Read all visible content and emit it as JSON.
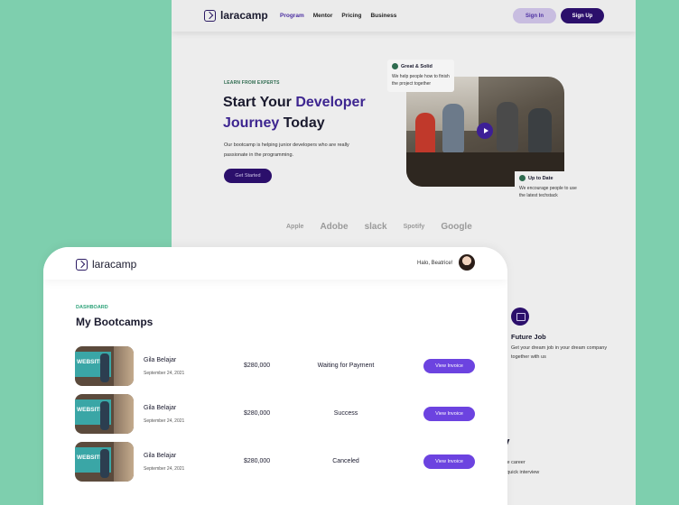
{
  "landing": {
    "logo": "laracamp",
    "menu": [
      "Program",
      "Mentor",
      "Pricing",
      "Business"
    ],
    "signin": "Sign In",
    "signup": "Sign Up",
    "eyebrow": "LEARN FROM EXPERTS",
    "title_1": "Start Your ",
    "title_hl1": "Developer",
    "title_hl2": "Journey",
    "title_2": " Today",
    "desc": "Our bootcamp is helping junior developers who are really passionate in the programming.",
    "cta": "Get Started",
    "card_great": {
      "title": "Great & Solid",
      "text": "We help people how to finish the project together"
    },
    "card_up": {
      "title": "Up to Date",
      "text": "We encourage people to use the latest techstack"
    },
    "brands": [
      "Apple",
      "Adobe",
      "slack",
      "Spotify",
      "Google"
    ],
    "future": {
      "title": "Future Job",
      "text": "Get your dream job in your dream company together with us"
    },
    "partial_heading": "ey",
    "partial_line1": "uture career",
    "partial_line2": "g a quick interview"
  },
  "dashboard": {
    "logo": "laracamp",
    "greeting": "Halo, Beatrice!",
    "eyebrow": "DASHBOARD",
    "title": "My Bootcamps",
    "thumb_text": "WEBSITE",
    "rows": [
      {
        "name": "Gila Belajar",
        "date": "September 24, 2021",
        "price": "$280,000",
        "status": "Waiting for Payment",
        "action": "View Invoice"
      },
      {
        "name": "Gila Belajar",
        "date": "September 24, 2021",
        "price": "$280,000",
        "status": "Success",
        "action": "View Invoice"
      },
      {
        "name": "Gila Belajar",
        "date": "September 24, 2021",
        "price": "$280,000",
        "status": "Canceled",
        "action": "View Invoice"
      }
    ]
  },
  "colors": {
    "background": "#7ecfae",
    "primary": "#2b0f6b",
    "accent": "#6c43e0",
    "highlight": "#3d2590",
    "green": "#2fa37a"
  }
}
